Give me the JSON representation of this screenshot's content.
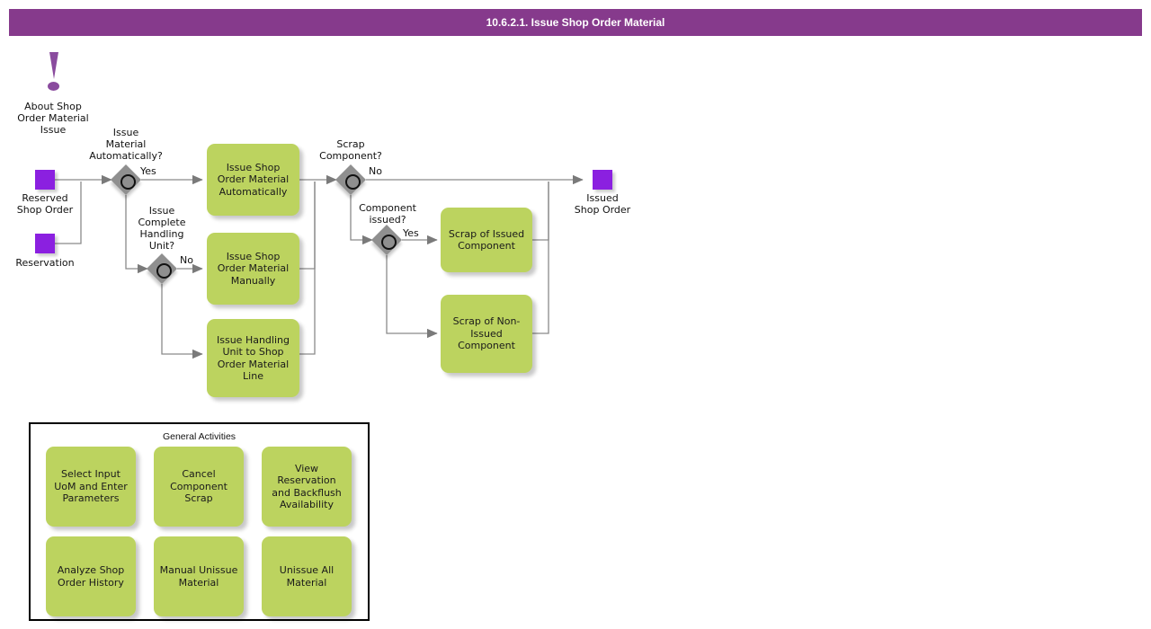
{
  "header": {
    "title": "10.6.2.1. Issue Shop Order Material",
    "bg_color": "#863a8c",
    "text_color": "#ffffff"
  },
  "colors": {
    "task_green": "#bcd35f",
    "data_purple": "#8b20e0",
    "gateway_gray": "#8f8f8f",
    "info_purple": "#8a4b9e",
    "line": "#808080",
    "panel_border": "#000000"
  },
  "info_note": {
    "icon": "exclamation-icon",
    "label": "About Shop\nOrder Material\nIssue"
  },
  "data_objects": [
    {
      "name": "reserved-shop-order",
      "label": "Reserved\nShop Order"
    },
    {
      "name": "reservation",
      "label": "Reservation"
    },
    {
      "name": "issued-shop-order",
      "label": "Issued\nShop Order"
    }
  ],
  "gateways": [
    {
      "name": "issue-material-automatically",
      "label": "Issue\nMaterial\nAutomatically?",
      "branches": [
        "Yes",
        "No"
      ]
    },
    {
      "name": "issue-complete-handling-unit",
      "label": "Issue\nComplete\nHandling\nUnit?",
      "branches": [
        "No"
      ]
    },
    {
      "name": "scrap-component",
      "label": "Scrap\nComponent?",
      "branches": [
        "No"
      ]
    },
    {
      "name": "component-issued",
      "label": "Component\nissued?",
      "branches": [
        "Yes"
      ]
    }
  ],
  "branch_labels": {
    "gw1_yes": "Yes",
    "gw2_no": "No",
    "gw3_no": "No",
    "gw4_yes": "Yes"
  },
  "tasks": [
    {
      "name": "issue-shop-order-material-automatically",
      "label": "Issue Shop\nOrder Material\nAutomatically"
    },
    {
      "name": "issue-shop-order-material-manually",
      "label": "Issue Shop\nOrder Material\nManually"
    },
    {
      "name": "issue-handling-unit-to-shop-order-material-line",
      "label": "Issue Handling\nUnit to Shop\nOrder Material\nLine"
    },
    {
      "name": "scrap-of-issued-component",
      "label": "Scrap of Issued\nComponent"
    },
    {
      "name": "scrap-of-non-issued-component",
      "label": "Scrap of Non-\nIssued\nComponent"
    }
  ],
  "general_activities": {
    "title": "General Activities",
    "items": [
      {
        "name": "select-input-uom-and-enter-parameters",
        "label": "Select Input\nUoM and Enter\nParameters"
      },
      {
        "name": "cancel-component-scrap",
        "label": "Cancel\nComponent\nScrap"
      },
      {
        "name": "view-reservation-and-backflush-availability",
        "label": "View\nReservation and\nBackflush\nAvailability"
      },
      {
        "name": "analyze-shop-order-history",
        "label": "Analyze Shop\nOrder History"
      },
      {
        "name": "manual-unissue-material",
        "label": "Manual Unissue\nMaterial"
      },
      {
        "name": "unissue-all-material",
        "label": "Unissue All\nMaterial"
      }
    ]
  }
}
